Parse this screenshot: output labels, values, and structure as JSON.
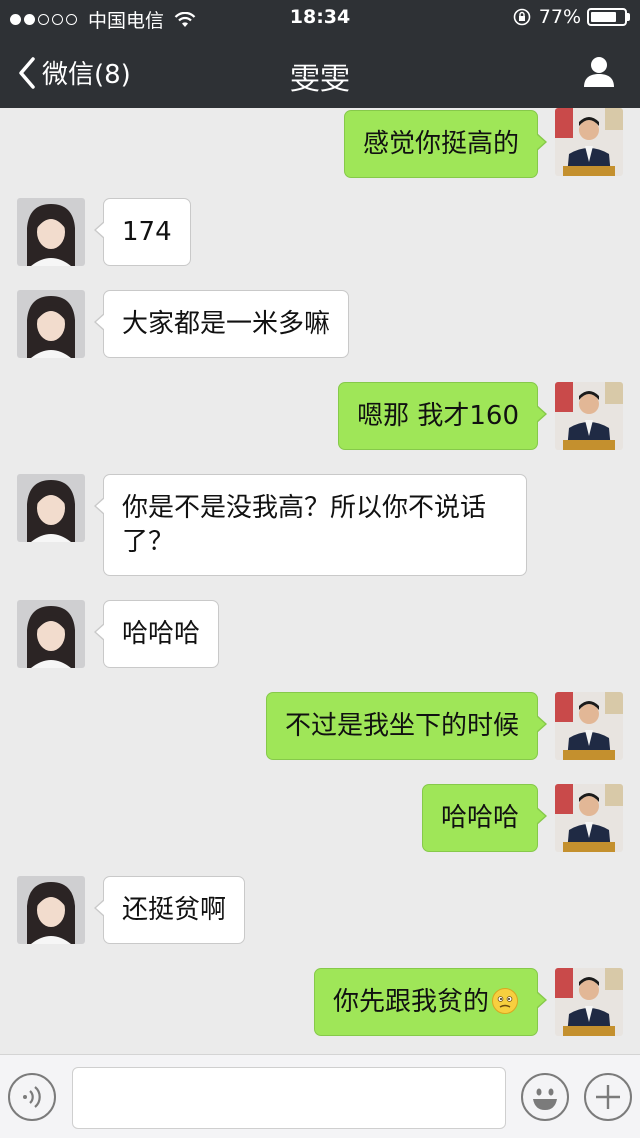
{
  "status_bar": {
    "carrier": "中国电信",
    "time": "18:34",
    "battery_text": "77%",
    "battery_level": 0.77,
    "signal_bars_filled": 2,
    "signal_bars_total": 5
  },
  "nav": {
    "back_label": "微信(8)",
    "title": "雯雯"
  },
  "messages": [
    {
      "side": "out",
      "text": "感觉你挺高的"
    },
    {
      "side": "in",
      "text": "174"
    },
    {
      "side": "in",
      "text": "大家都是一米多嘛"
    },
    {
      "side": "out",
      "text": "嗯那 我才160"
    },
    {
      "side": "in",
      "text": "你是不是没我高？所以你不说话了？"
    },
    {
      "side": "in",
      "text": "哈哈哈"
    },
    {
      "side": "out",
      "text": "不过是我坐下的时候"
    },
    {
      "side": "out",
      "text": "哈哈哈"
    },
    {
      "side": "in",
      "text": "还挺贫啊"
    },
    {
      "side": "out",
      "text": "你先跟我贫的",
      "emoji": "confused-face-icon"
    }
  ],
  "input": {
    "value": "",
    "placeholder": ""
  },
  "colors": {
    "bar_bg": "#2e3135",
    "chat_bg": "#ebebeb",
    "out_bubble": "#9fe658",
    "in_bubble": "#ffffff"
  }
}
